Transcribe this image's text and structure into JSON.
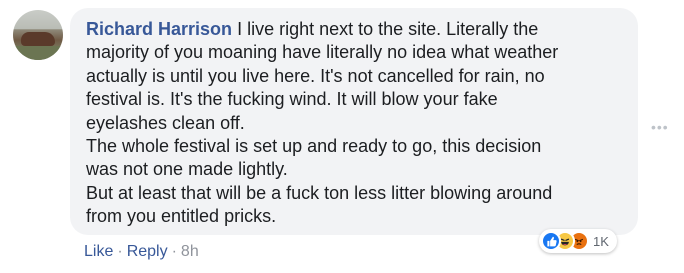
{
  "comment": {
    "author": "Richard Harrison",
    "text": "I live right next to the site. Literally the\nmajority of you moaning have literally no idea what weather\nactually is until you live here. It's not cancelled for rain, no\nfestival is. It's the fucking wind. It will blow your fake\neyelashes clean off.\nThe whole festival is set up and ready to go, this decision\nwas not one made lightly.\nBut at least that will be a fuck ton less litter blowing around\nfrom you entitled pricks."
  },
  "reactions": {
    "icons": [
      "like-icon",
      "haha-icon",
      "angry-icon"
    ],
    "count": "1K"
  },
  "actions": {
    "like_label": "Like",
    "reply_label": "Reply",
    "separator": "·",
    "time": "8h"
  },
  "more_options": "•••",
  "colors": {
    "bubble": "#f2f3f5",
    "author": "#385898",
    "text": "#1c1e21",
    "meta": "#90949c",
    "like": "#1877f2",
    "haha": "#f7c845",
    "angry": "#e9710f"
  }
}
